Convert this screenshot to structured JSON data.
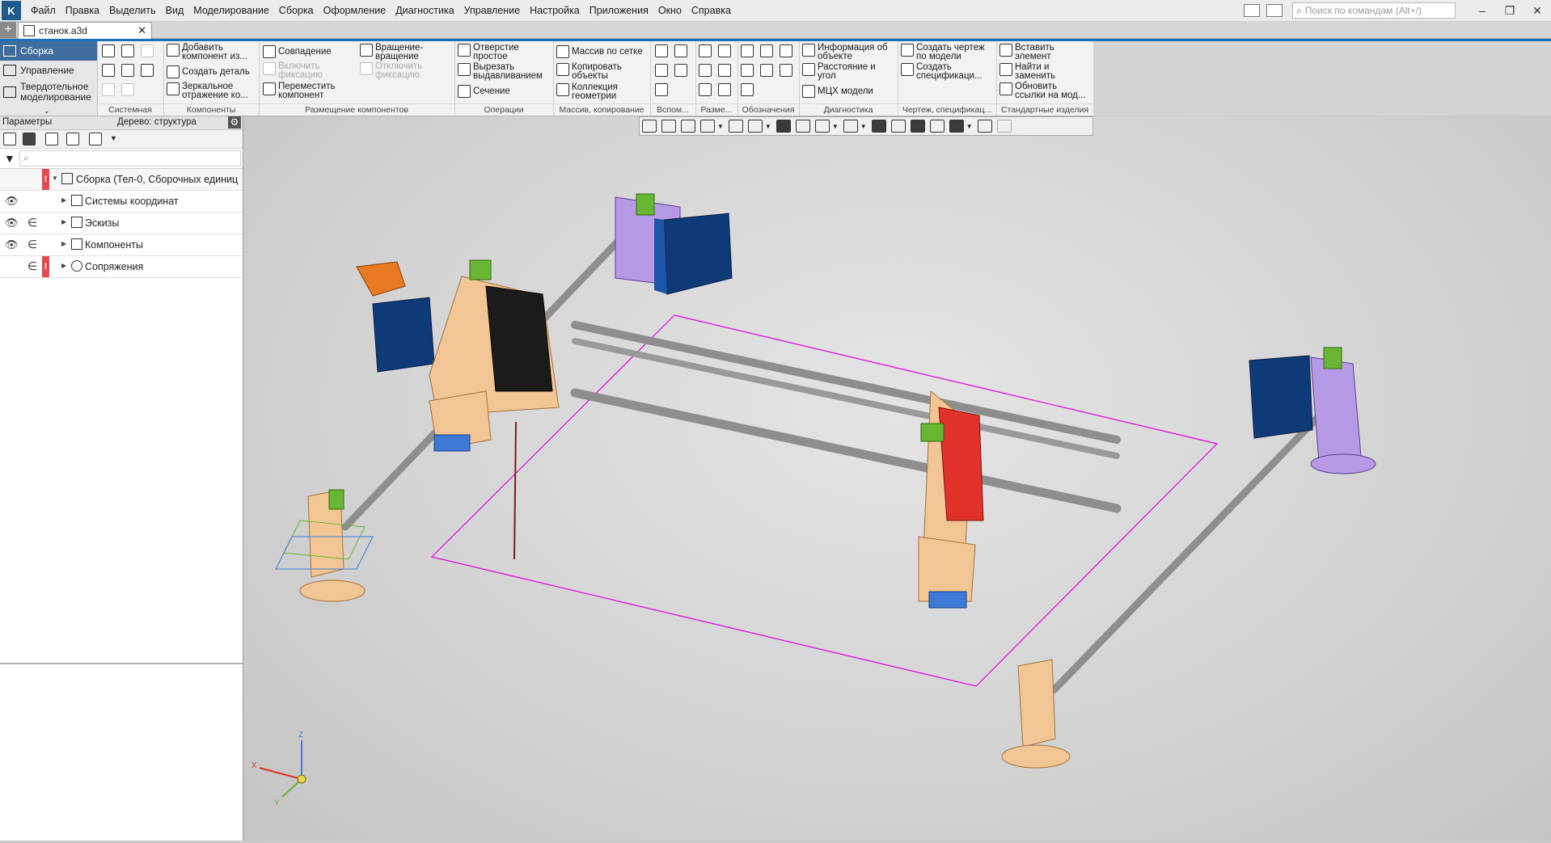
{
  "app": {
    "logo_letter": "K"
  },
  "menu": [
    "Файл",
    "Правка",
    "Выделить",
    "Вид",
    "Моделирование",
    "Сборка",
    "Оформление",
    "Диагностика",
    "Управление",
    "Настройка",
    "Приложения",
    "Окно",
    "Справка"
  ],
  "search": {
    "placeholder": "Поиск по командам (Alt+/)"
  },
  "window_controls": {
    "minimize": "–",
    "restore": "❐",
    "close": "✕"
  },
  "tabs": {
    "add": "+",
    "document": "станок.a3d",
    "close": "✕"
  },
  "sidebar": {
    "items": [
      {
        "label": "Сборка",
        "active": true
      },
      {
        "label": "Управление",
        "active": false
      },
      {
        "label_line1": "Твердотельное",
        "label_line2": "моделирование",
        "active": false
      }
    ]
  },
  "ribbon": {
    "groups": [
      "Системная",
      "Компоненты",
      "Размещение компонентов",
      "Операции",
      "Массив, копирование",
      "Вспом...",
      "Разме...",
      "Обозначения",
      "Диагностика",
      "Чертеж, спецификац...",
      "Стандартные изделия"
    ],
    "components": {
      "add_component_1": "Добавить",
      "add_component_2": "компонент из...",
      "create_part": "Создать деталь",
      "mirror_1": "Зеркальное",
      "mirror_2": "отражение ко..."
    },
    "placement": {
      "coincidence": "Совпадение",
      "enable_fix_1": "Включить",
      "enable_fix_2": "фиксацию",
      "move_1": "Переместить",
      "move_2": "компонент",
      "rotation_1": "Вращение-",
      "rotation_2": "вращение",
      "disable_fix_1": "Отключить",
      "disable_fix_2": "фиксацию"
    },
    "operations": {
      "hole_1": "Отверстие",
      "hole_2": "простое",
      "cut_1": "Вырезать",
      "cut_2": "выдавливанием",
      "section": "Сечение"
    },
    "array": {
      "grid": "Массив по сетке",
      "copy_1": "Копировать",
      "copy_2": "объекты",
      "collection_1": "Коллекция",
      "collection_2": "геометрии"
    },
    "diagnostics": {
      "info_1": "Информация об",
      "info_2": "объекте",
      "distance_1": "Расстояние и",
      "distance_2": "угол",
      "mass": "МЦХ модели"
    },
    "drawing": {
      "create_drawing_1": "Создать чертеж",
      "create_drawing_2": "по модели",
      "create_spec_1": "Создать",
      "create_spec_2": "спецификаци..."
    },
    "standard": {
      "insert_1": "Вставить",
      "insert_2": "элемент",
      "find_1": "Найти и",
      "find_2": "заменить",
      "update_1": "Обновить",
      "update_2": "ссылки на мод..."
    }
  },
  "panel": {
    "params_tab": "Параметры",
    "tree_tab": "Дерево: структура",
    "gear": "⚙",
    "tree": [
      {
        "label": "Сборка (Тел-0, Сборочных единиц",
        "eye": "",
        "inset": "",
        "error": "!"
      },
      {
        "label": "Системы координат",
        "eye": "👁",
        "inset": "",
        "error": ""
      },
      {
        "label": "Эскизы",
        "eye": "👁",
        "inset": "∈",
        "error": ""
      },
      {
        "label": "Компоненты",
        "eye": "👁",
        "inset": "∈",
        "error": ""
      },
      {
        "label": "Сопряжения",
        "eye": "",
        "inset": "∈",
        "error": "!"
      }
    ]
  },
  "axes": {
    "x": "X",
    "y": "Y",
    "z": "Z"
  },
  "colors": {
    "rod": "#8e8e8e",
    "motor": "#0f3a78",
    "bracket_purple": "#b79ae6",
    "plate_wood": "#f2c694",
    "green_clip": "#68b634",
    "red_block": "#e0312b",
    "orange_mount": "#e87a22",
    "magenta_frame": "#e000e0",
    "blue_part": "#3d7ad6"
  }
}
